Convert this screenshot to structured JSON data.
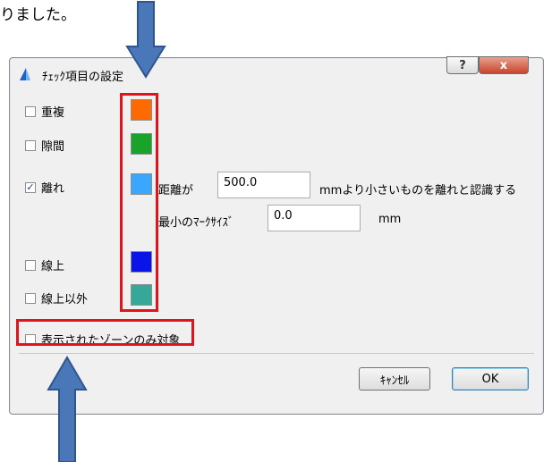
{
  "caption": "りました。",
  "dialog": {
    "title": "ﾁｪｯｸ項目の設定",
    "help_label": "?",
    "close_label": "x",
    "items": [
      {
        "label": "重複",
        "checked": false,
        "color": "#ff6a00"
      },
      {
        "label": "隙間",
        "checked": false,
        "color": "#1aa32a"
      },
      {
        "label": "離れ",
        "checked": true,
        "color": "#3aa7ff"
      },
      {
        "label": "線上",
        "checked": false,
        "color": "#0a14e8"
      },
      {
        "label": "線上以外",
        "checked": false,
        "color": "#36a898"
      }
    ],
    "distance_label": "距離が",
    "distance_value": "500.0",
    "distance_suffix": "mmより小さいものを離れと認識する",
    "marker_label": "最小のﾏｰｸｻｲｽﾞ",
    "marker_value": "0.0",
    "marker_unit": "mm",
    "visible_zone_label": "表示されたゾーンのみ対象",
    "cancel_label": "ｷｬﾝｾﾙ",
    "ok_label": "OK"
  },
  "colors": {
    "highlight": "#e0141e",
    "arrow": "#4a77b8"
  }
}
